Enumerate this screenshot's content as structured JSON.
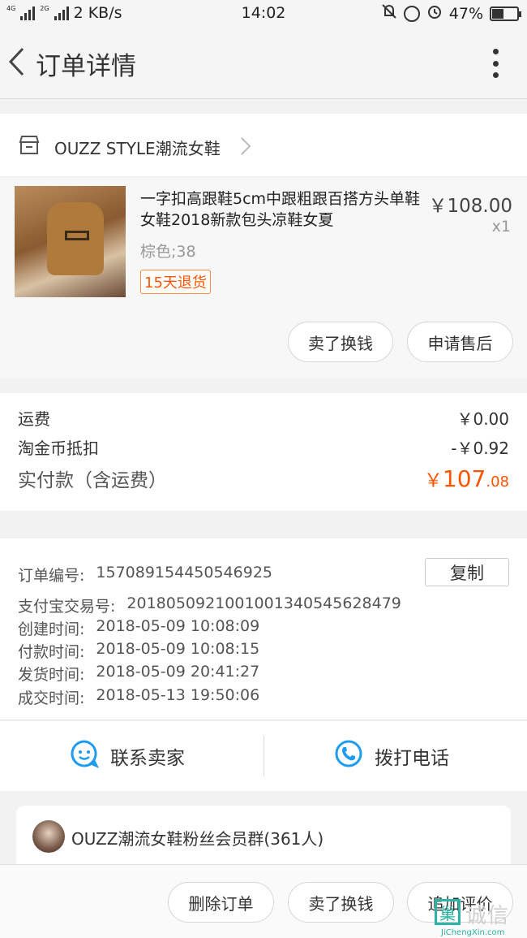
{
  "status_bar": {
    "net_tags": [
      "4G",
      "2G"
    ],
    "speed": "2 KB/s",
    "time": "14:02",
    "battery": "47%",
    "battery_level": 0.47
  },
  "nav": {
    "title": "订单详情"
  },
  "shop": {
    "name": "OUZZ STYLE潮流女鞋"
  },
  "item": {
    "title": "一字扣高跟鞋5cm中跟粗跟百搭方头单鞋女鞋2018新款包头凉鞋女夏",
    "price": "￥108.00",
    "qty": "x1",
    "sku": "棕色;38",
    "tag": "15天退货",
    "buttons": {
      "resell": "卖了换钱",
      "after_sales": "申请售后"
    }
  },
  "fees": {
    "shipping_label": "运费",
    "shipping_value": "￥0.00",
    "coin_label": "淘金币抵扣",
    "coin_value": "-￥0.92",
    "total_label": "实付款（含运费）",
    "total_currency": "￥",
    "total_int": "107",
    "total_dec": ".08",
    "accent_color": "#ff5500"
  },
  "order_info": {
    "order_no_label": "订单编号:",
    "order_no": "1570891544505469 25",
    "copy_label": "复制",
    "alipay_label": "支付宝交易号:",
    "alipay_no": "2018050921001001340545628479",
    "created_label": "创建时间:",
    "created": "2018-05-09 10:08:09",
    "paid_label": "付款时间:",
    "paid": "2018-05-09 10:08:15",
    "shipped_label": "发货时间:",
    "shipped": "2018-05-09 20:41:27",
    "done_label": "成交时间:",
    "done": "2018-05-13 19:50:06"
  },
  "contact": {
    "seller": "联系卖家",
    "phone": "拨打电话",
    "icon_color": "#1e9cf0"
  },
  "group": {
    "name": "OUZZ潮流女鞋粉丝会员群(361人)"
  },
  "bottom": {
    "delete": "删除订单",
    "resell": "卖了换钱",
    "review": "追加评价"
  },
  "watermark": {
    "logo_char": "巢",
    "text": "诚信",
    "url": "JiChengXin.com"
  }
}
